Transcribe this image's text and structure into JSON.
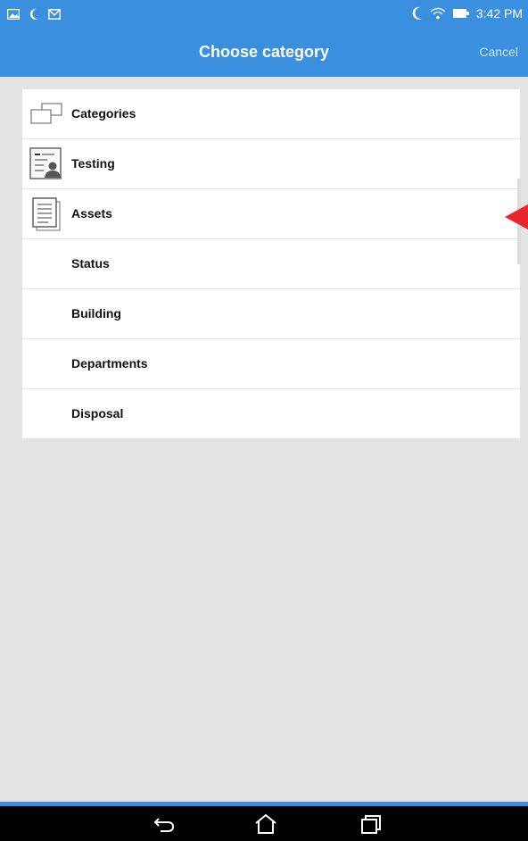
{
  "status_bar": {
    "time": "3:42 PM",
    "left_icons": [
      "photo-icon",
      "moon-icon",
      "gmail-icon"
    ],
    "right_icons": [
      "moon-icon",
      "wifi-icon",
      "battery-icon"
    ]
  },
  "app_bar": {
    "title": "Choose category",
    "cancel_label": "Cancel"
  },
  "categories": [
    {
      "label": "Categories",
      "icon": "folders-icon"
    },
    {
      "label": "Testing",
      "icon": "contact-card-icon"
    },
    {
      "label": "Assets",
      "icon": "document-stack-icon"
    },
    {
      "label": "Status",
      "icon": ""
    },
    {
      "label": "Building",
      "icon": ""
    },
    {
      "label": "Departments",
      "icon": ""
    },
    {
      "label": "Disposal",
      "icon": ""
    }
  ],
  "colors": {
    "header": "#3a8fde",
    "background": "#e3e3e3",
    "pointer_arrow": "#e8262b"
  },
  "nav_bar": {
    "buttons": [
      "back-icon",
      "home-icon",
      "recent-apps-icon"
    ]
  }
}
